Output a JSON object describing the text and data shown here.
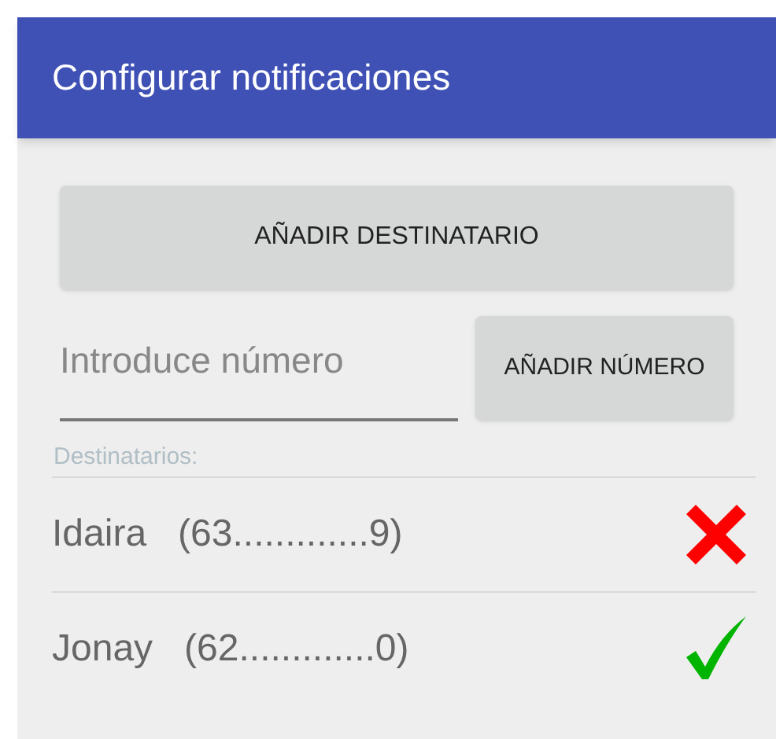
{
  "toolbar": {
    "title": "Configurar notificaciones"
  },
  "add_recipient_button": "AÑADIR DESTINATARIO",
  "number_field": {
    "placeholder": "Introduce número"
  },
  "add_number_button": "AÑADIR NÚMERO",
  "recipients_label": "Destinatarios:",
  "recipients": [
    {
      "name": "Idaira",
      "number": "(63.............9)",
      "enabled": false
    },
    {
      "name": "Jonay",
      "number": "(62.............0)",
      "enabled": true
    }
  ]
}
